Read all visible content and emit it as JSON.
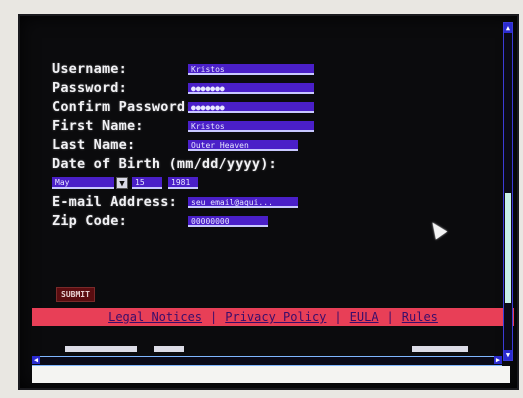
{
  "form": {
    "username": {
      "label": "Username:",
      "value": "Kristos"
    },
    "password": {
      "label": "Password:",
      "value": "●●●●●●●"
    },
    "confirm_password": {
      "label": "Confirm Password:",
      "value": "●●●●●●●"
    },
    "first_name": {
      "label": "First Name:",
      "value": "Kristos"
    },
    "last_name": {
      "label": "Last Name:",
      "value": "Outer Heaven"
    },
    "dob": {
      "label": "Date of Birth (mm/dd/yyyy):",
      "month": "May",
      "dropdown_glyph": "▼",
      "day": "15",
      "year": "1981"
    },
    "email": {
      "label": "E-mail Address:",
      "value": "seu_email@aqui..."
    },
    "zip": {
      "label": "Zip Code:",
      "value": "00000000"
    }
  },
  "submit_label": "SUBMIT",
  "footer_links": [
    "Legal Notices",
    "Privacy Policy",
    "EULA",
    "Rules"
  ],
  "footer_separator": "|",
  "scroll": {
    "up": "▲",
    "down": "▼",
    "left": "◀",
    "right": "▶"
  },
  "colors": {
    "screen_bg": "#0b0b0d",
    "field": "#4a1fc8",
    "footer": "#e83f57",
    "text": "#f1f1f4"
  }
}
